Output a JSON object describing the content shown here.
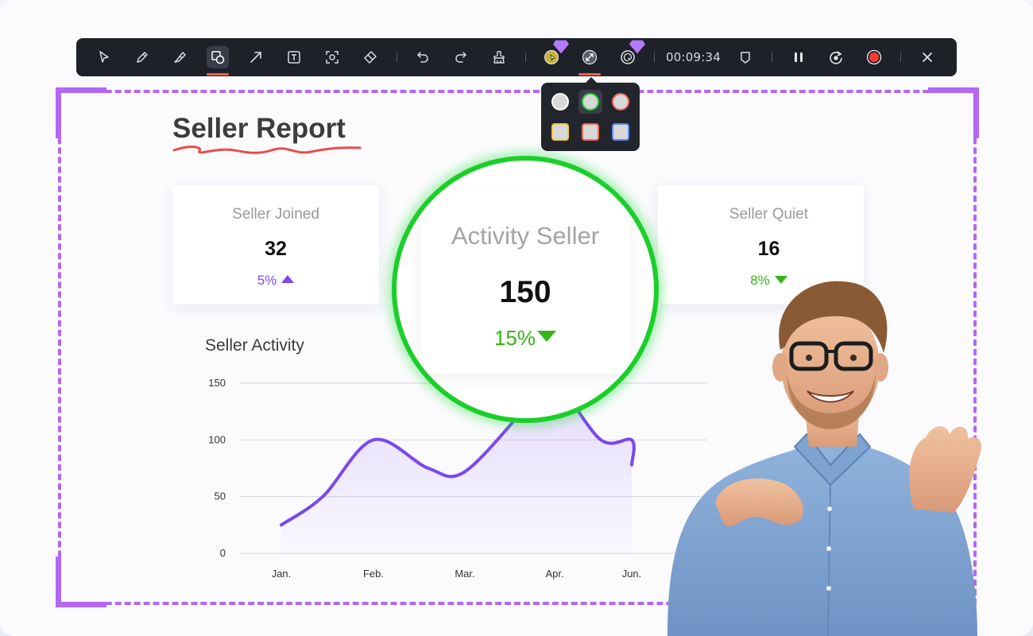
{
  "toolbar": {
    "timer": "00:09:34",
    "tools": [
      {
        "name": "select-tool-button",
        "icon": "cursor-icon"
      },
      {
        "name": "pen-tool-button",
        "icon": "pen-icon"
      },
      {
        "name": "highlighter-tool-button",
        "icon": "highlighter-icon"
      },
      {
        "name": "shape-tool-button",
        "icon": "shapes-icon",
        "active": true
      },
      {
        "name": "arrow-tool-button",
        "icon": "arrow-icon"
      },
      {
        "name": "text-tool-button",
        "icon": "text-icon"
      },
      {
        "name": "spotlight-tool-button",
        "icon": "focus-icon"
      },
      {
        "name": "eraser-tool-button",
        "icon": "eraser-icon"
      },
      {
        "name": "undo-button",
        "icon": "undo-icon"
      },
      {
        "name": "redo-button",
        "icon": "redo-icon"
      },
      {
        "name": "clear-button",
        "icon": "broom-icon"
      },
      {
        "name": "cursor-highlight-button",
        "icon": "cursor-highlight-icon",
        "premium": true
      },
      {
        "name": "magnifier-button",
        "icon": "magnify-icon",
        "active": true
      },
      {
        "name": "click-effect-button",
        "icon": "click-ring-icon",
        "premium": true
      },
      {
        "name": "watermark-button",
        "icon": "shield-icon"
      },
      {
        "name": "pause-button",
        "icon": "pause-icon"
      },
      {
        "name": "restart-button",
        "icon": "restart-icon"
      },
      {
        "name": "record-button",
        "icon": "record-icon"
      },
      {
        "name": "close-button",
        "icon": "close-icon"
      }
    ],
    "colors": {
      "accent": "#ff5a4e",
      "premium": "#b57bff",
      "bg": "#1f2129"
    }
  },
  "popover": {
    "swatches": [
      {
        "shape": "circle",
        "fill": "#d8d8d8",
        "border": "#ffffff"
      },
      {
        "shape": "circle",
        "fill": "#d8d8d8",
        "border": "#2bd43c",
        "selected": true
      },
      {
        "shape": "circle",
        "fill": "#d8d8d8",
        "border": "#f26b5b"
      },
      {
        "shape": "square",
        "fill": "#d8d8d8",
        "border": "#f2c744"
      },
      {
        "shape": "square",
        "fill": "#d8d8d8",
        "border": "#f26b5b"
      },
      {
        "shape": "square",
        "fill": "#d8d8d8",
        "border": "#5b8cf2"
      }
    ]
  },
  "report": {
    "title": "Seller Report",
    "cards": [
      {
        "label": "Seller Joined",
        "value": "32",
        "delta": "5%",
        "trend": "up",
        "color": "#7a47f0"
      },
      {
        "label": "Activity Seller",
        "value": "150",
        "delta": "15%",
        "trend": "down",
        "color": "#36b517"
      },
      {
        "label": "Seller Quiet",
        "value": "16",
        "delta": "8%",
        "trend": "down",
        "color": "#36b517"
      }
    ],
    "magnified": {
      "label": "Activity Seller",
      "value": "150",
      "delta": "15%"
    }
  },
  "chart_data": {
    "type": "area",
    "title": "Seller Activity",
    "categories": [
      "Jan.",
      "Feb.",
      "Mar.",
      "Apr.",
      "Jun."
    ],
    "y_ticks": [
      "150",
      "100",
      "50",
      "0"
    ],
    "ylim": [
      0,
      150
    ],
    "series": [
      {
        "x": [
          0.0,
          0.45,
          1.0,
          1.6,
          2.0,
          2.7,
          3.0,
          3.6,
          4.0,
          4.5
        ],
        "values": [
          25,
          50,
          100,
          75,
          72,
          130,
          150,
          100,
          100,
          78
        ]
      }
    ],
    "grid": true,
    "line_color": "#7a47f0"
  }
}
